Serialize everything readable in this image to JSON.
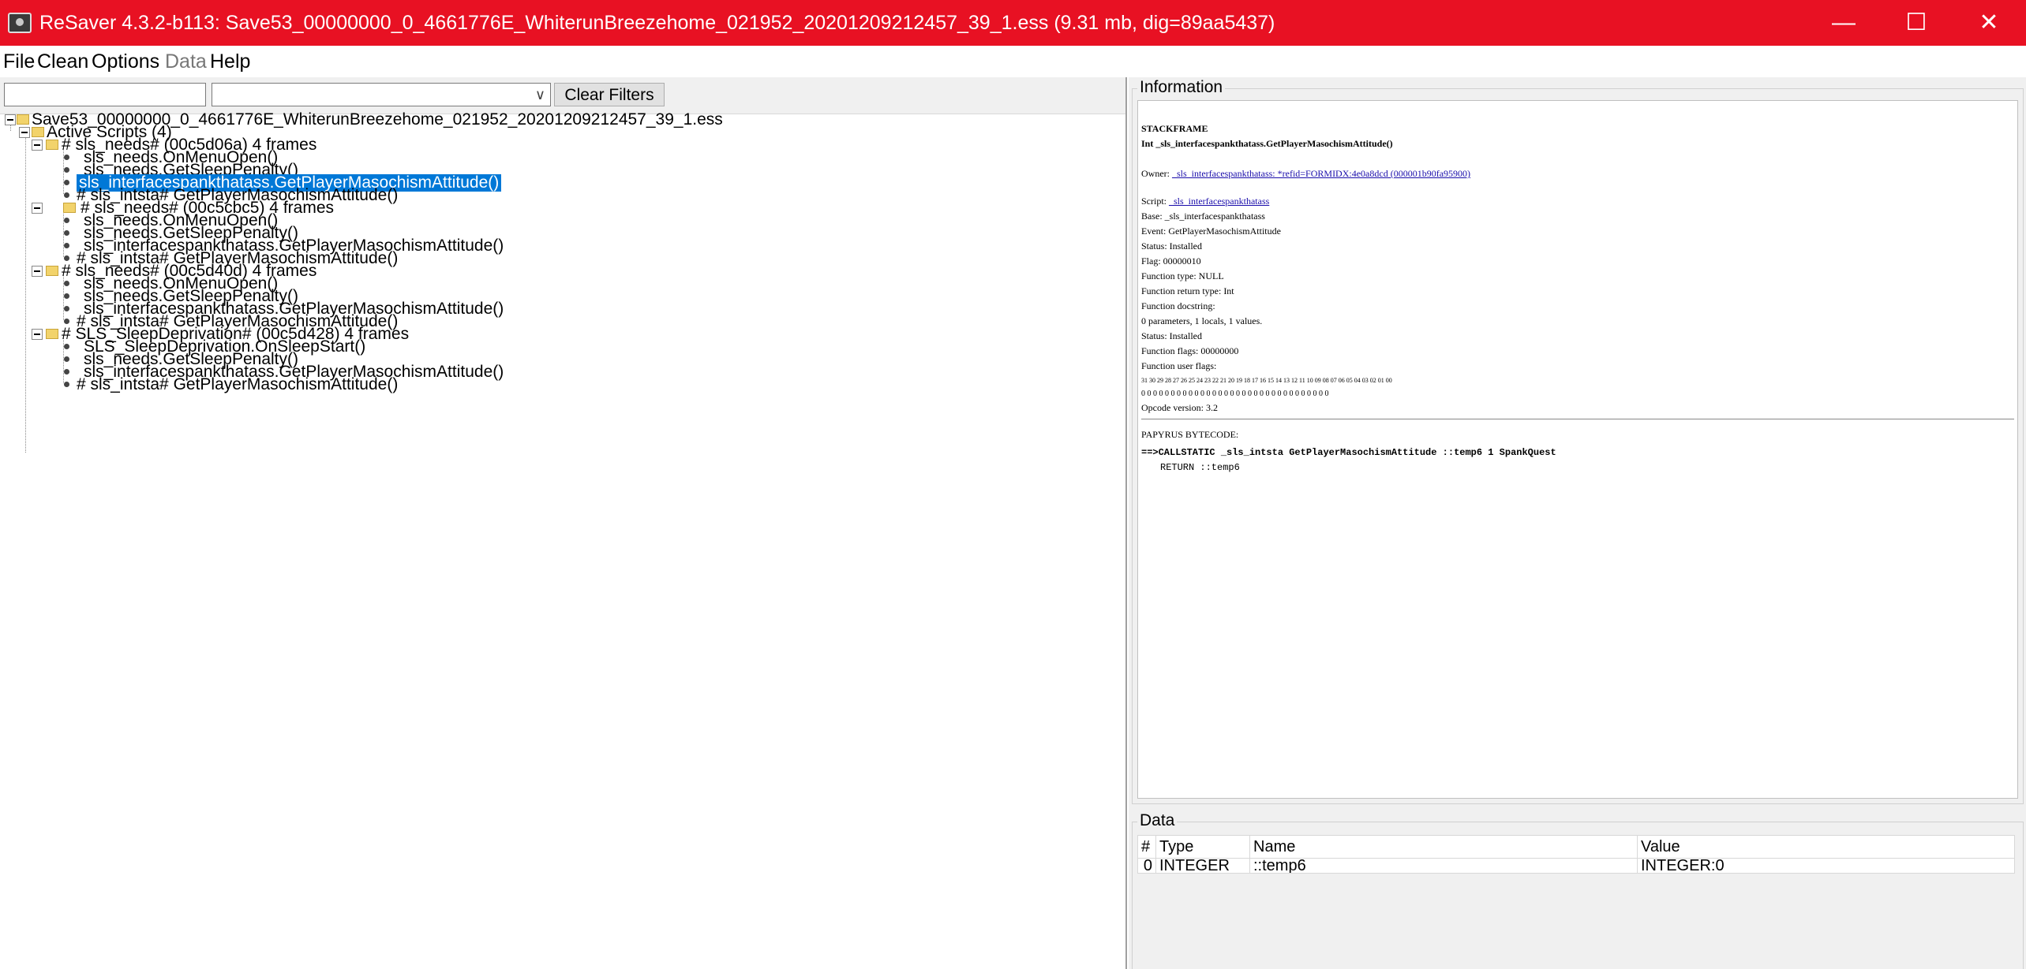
{
  "window": {
    "title": "ReSaver 4.3.2-b113: Save53_00000000_0_4661776E_WhiterunBreezehome_021952_20201209212457_39_1.ess (9.31 mb, dig=89aa5437)",
    "minimize_icon": "minimize-icon",
    "maximize_icon": "maximize-icon",
    "close_icon": "close-icon"
  },
  "menu": {
    "file": "File",
    "clean": "Clean",
    "options": "Options",
    "data": "Data",
    "help": "Help"
  },
  "filters": {
    "text_value": "",
    "combo_value": "",
    "clear_label": "Clear Filters"
  },
  "tree": {
    "root": "Save53_00000000_0_4661776E_WhiterunBreezehome_021952_20201209212457_39_1.ess",
    "active_scripts": "Active Scripts (4)",
    "groups": [
      {
        "label": "# sls_needs# (00c5d06a) 4 frames",
        "frames": [
          "sls_needs.OnMenuOpen()",
          "sls_needs.GetSleepPenalty()",
          "sls_interfacespankthatass.GetPlayerMasochismAttitude()",
          "# sls_intsta# GetPlayerMasochismAttitude()"
        ]
      },
      {
        "label": "# sls_needs# (00c5cbc5) 4 frames",
        "frames": [
          "sls_needs.OnMenuOpen()",
          "sls_needs.GetSleepPenalty()",
          "sls_interfacespankthatass.GetPlayerMasochismAttitude()",
          "# sls_intsta# GetPlayerMasochismAttitude()"
        ]
      },
      {
        "label": "# sls_needs# (00c5d40d) 4 frames",
        "frames": [
          "sls_needs.OnMenuOpen()",
          "sls_needs.GetSleepPenalty()",
          "sls_interfacespankthatass.GetPlayerMasochismAttitude()",
          "# sls_intsta# GetPlayerMasochismAttitude()"
        ]
      },
      {
        "label": "# SLS_SleepDeprivation# (00c5d428) 4 frames",
        "frames": [
          "SLS_SleepDeprivation.OnSleepStart()",
          "sls_needs.GetSleepPenalty()",
          "sls_interfacespankthatass.GetPlayerMasochismAttitude()",
          "# sls_intsta# GetPlayerMasochismAttitude()"
        ]
      }
    ]
  },
  "information": {
    "title": "Information",
    "heading": "STACKFRAME",
    "signature": "Int _sls_interfacespankthatass.GetPlayerMasochismAttitude()",
    "owner_label": "Owner:",
    "owner_link": "_sls_interfacespankthatass: *refid=FORMIDX:4e0a8dcd (000001b90fa95900)",
    "script_label": "Script:",
    "script_link": "_sls_interfacespankthatass",
    "base": "Base: _sls_interfacespankthatass",
    "event": "Event: GetPlayerMasochismAttitude",
    "status": "Status: Installed",
    "flag": "Flag: 00000010",
    "function_type": "Function type: NULL",
    "return_type": "Function return type: Int",
    "docstring": "Function docstring:",
    "params": "0 parameters, 1 locals, 1 values.",
    "status2": "Status: Installed",
    "function_flags": "Function flags: 00000000",
    "user_flags": "Function user flags:",
    "flag_indices": "31 30 29 28 27 26 25 24 23 22 21 20 19 18 17 16 15 14 13 12 11 10 09 08 07 06 05 04 03 02 01 00",
    "flag_values": "0  0  0  0  0  0  0  0  0  0  0  0  0  0  0  0  0  0  0  0  0  0  0  0  0  0  0  0  0  0  0  0",
    "opcode_version": "Opcode version: 3.2",
    "bytecode_label": "PAPYRUS BYTECODE:",
    "bytecode_line1": "==>CALLSTATIC _sls_intsta GetPlayerMasochismAttitude ::temp6 1 SpankQuest",
    "bytecode_line2": "RETURN ::temp6"
  },
  "data_panel": {
    "title": "Data",
    "columns": [
      "#",
      "Type",
      "Name",
      "Value"
    ],
    "rows": [
      [
        "0",
        "INTEGER",
        "::temp6",
        "INTEGER:0"
      ]
    ]
  }
}
